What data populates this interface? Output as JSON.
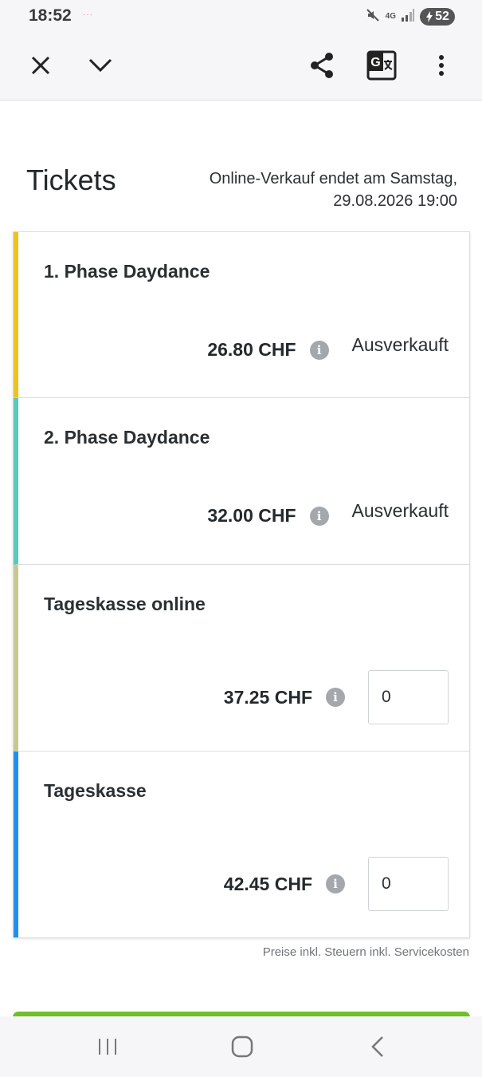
{
  "statusbar": {
    "time": "18:52",
    "notif": "···",
    "network": "4G",
    "battery": "52"
  },
  "toolbar": {
    "icons": [
      "close-icon",
      "chevron-down-icon",
      "share-icon",
      "translate-icon",
      "more-vert-icon"
    ]
  },
  "header": {
    "title": "Tickets",
    "sale_end_line1": "Online-Verkauf endet am Samstag,",
    "sale_end_line2": "29.08.2026 19:00"
  },
  "tickets": [
    {
      "name": "1. Phase Daydance",
      "price": "26.80 CHF",
      "status": "Ausverkauft",
      "accent": "#efc21f"
    },
    {
      "name": "2. Phase Daydance",
      "price": "32.00 CHF",
      "status": "Ausverkauft",
      "accent": "#58c9bb"
    },
    {
      "name": "Tageskasse online",
      "price": "37.25 CHF",
      "quantity": "0",
      "accent": "#c9c98f"
    },
    {
      "name": "Tageskasse",
      "price": "42.45 CHF",
      "quantity": "0",
      "accent": "#1f8ff0"
    }
  ],
  "footnote": "Preise inkl. Steuern inkl. Servicekosten",
  "colors": {
    "cta": "#6fbf2a",
    "background": "#ffffff",
    "bar": "#f6f6f9"
  },
  "navbar": {
    "icons": [
      "recent-apps-icon",
      "home-icon",
      "back-icon"
    ]
  }
}
